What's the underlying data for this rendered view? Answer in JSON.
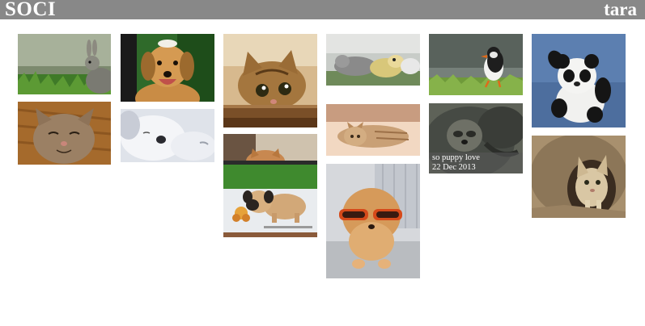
{
  "header": {
    "brand": "SOCI",
    "username": "tara",
    "bar_color": "#888888"
  },
  "photos": [
    {
      "subject": "rabbit in grass"
    },
    {
      "subject": "smiling kitten"
    },
    {
      "subject": "smiling puppy"
    },
    {
      "subject": "sleeping white puppy"
    },
    {
      "subject": "tabby kitten peeking over wood"
    },
    {
      "subject": "kitten behind ledge"
    },
    {
      "subject": "pug puppy with toy"
    },
    {
      "subject": "plush toys on grass"
    },
    {
      "subject": "kitten lying on bed"
    },
    {
      "subject": "pomeranian with sunglasses"
    },
    {
      "subject": "puffin"
    },
    {
      "subject": "baby sloth",
      "caption_title": "so puppy love",
      "caption_date": "22 Dec 2013"
    },
    {
      "subject": "baby panda"
    },
    {
      "subject": "sand cat kitten in burrow"
    }
  ]
}
